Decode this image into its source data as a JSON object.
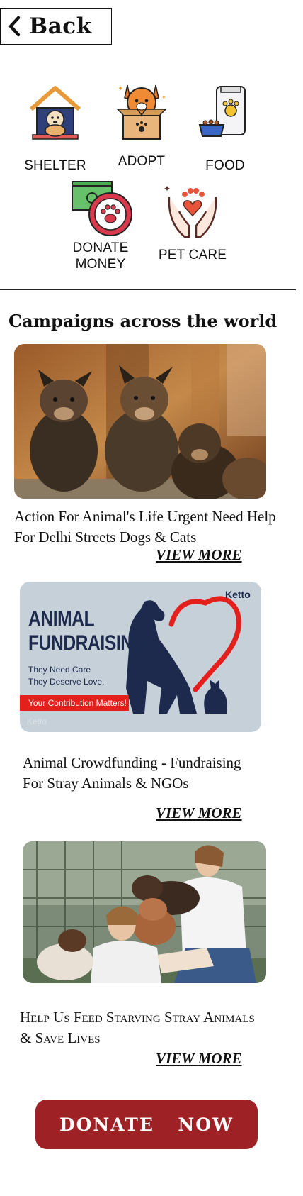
{
  "header": {
    "back_label": "Back"
  },
  "categories": [
    {
      "label": "SHELTER",
      "icon": "shelter-house-icon"
    },
    {
      "label": "ADOPT",
      "icon": "cat-in-box-icon"
    },
    {
      "label": "FOOD",
      "icon": "pet-food-icon"
    },
    {
      "label_line1": "DONATE",
      "label_line2": "MONEY",
      "icon": "money-paw-icon"
    },
    {
      "label": "PET CARE",
      "icon": "hands-paw-heart-icon"
    }
  ],
  "section": {
    "title": "Campaigns across the world"
  },
  "campaigns": [
    {
      "line1": "Action For Animal's Life Urgent Need Help",
      "line2": "For Delhi Streets Dogs & Cats",
      "view_more": "VIEW MORE"
    },
    {
      "poster": {
        "brand": "Ketto",
        "headline1": "ANIMAL",
        "headline2": "FUNDRAISING",
        "sub1": "They Need Care",
        "sub2": "They Deserve Love.",
        "banner": "Your Contribution Matters!",
        "watermark": "Ketto"
      },
      "line1": "Animal Crowdfunding - Fundraising",
      "line2": "For Stray Animals & NGOs",
      "view_more": "VIEW MORE"
    },
    {
      "line1": "Help Us Feed Starving Stray Animals",
      "line2": "& Save Lives",
      "view_more": "VIEW MORE"
    }
  ],
  "cta": {
    "donate_label": "DONATE  NOW"
  },
  "colors": {
    "cta": "#9e2225",
    "poster_bg": "#c5d0d8",
    "poster_navy": "#1d2a4d",
    "poster_red": "#e3201b"
  }
}
